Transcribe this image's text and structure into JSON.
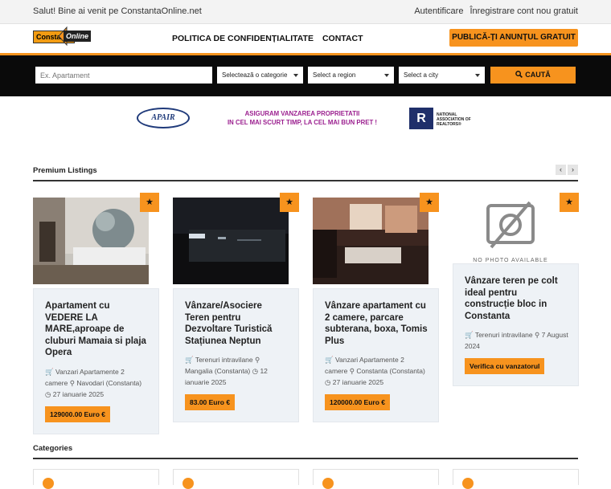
{
  "topbar": {
    "welcome": "Salut! Bine ai venit pe ConstantaOnline.net",
    "login": "Autentificare",
    "register": "Înregistrare cont nou gratuit"
  },
  "header": {
    "logo_part1": "Constanta",
    "logo_part2": "Online",
    "nav": [
      "POLITICA DE CONFIDENȚIALITATE",
      "CONTACT"
    ],
    "publish_button": "PUBLICĂ-ȚI ANUNȚUL GRATUIT"
  },
  "search": {
    "placeholder": "Ex. Apartament",
    "category": "Selectează o categorie",
    "region": "Select a region",
    "city": "Select a city",
    "button": "CAUTĂ"
  },
  "banner": {
    "apair_logo": "APAIR",
    "slogan_line1": "ASIGURAM VANZAREA PROPRIETATII",
    "slogan_line2": "IN CEL MAI SCURT TIMP, LA CEL MAI BUN PRET !",
    "nar_logo": "R",
    "nar_line1": "NATIONAL",
    "nar_line2": "ASSOCIATION OF",
    "nar_line3": "REALTORS®"
  },
  "premium": {
    "title": "Premium Listings",
    "prev": "‹",
    "next": "›",
    "listings": [
      {
        "title": "Apartament cu VEDERE LA MARE,aproape de cluburi Mamaia si plaja Opera",
        "category": "Vanzari Apartamente 2 camere",
        "location": "Navodari (Constanta)",
        "date": "27 ianuarie 2025",
        "price": "129000.00 Euro €"
      },
      {
        "title": "Vânzare/Asociere Teren pentru Dezvoltare Turistică Stațiunea Neptun",
        "category": "Terenuri intravilane",
        "location": "Mangalia (Constanta)",
        "date": "12 ianuarie 2025",
        "price": "83.00 Euro €"
      },
      {
        "title": "Vânzare apartament cu 2 camere, parcare subterana, boxa, Tomis Plus",
        "category": "Vanzari Apartamente 2 camere",
        "location": "Constanta (Constanta)",
        "date": "27 ianuarie 2025",
        "price": "120000.00 Euro €"
      },
      {
        "title": "Vânzare teren pe colt ideal pentru construcție bloc in Constanta",
        "category": "Terenuri intravilane",
        "location": "",
        "date": "7 August 2024",
        "price": "Verifica cu vanzatorul",
        "no_photo": "NO PHOTO AVAILABLE"
      }
    ]
  },
  "categories": {
    "title": "Categories"
  },
  "colors": {
    "accent": "#f7931e",
    "searchbar": "#0a0a0a"
  }
}
